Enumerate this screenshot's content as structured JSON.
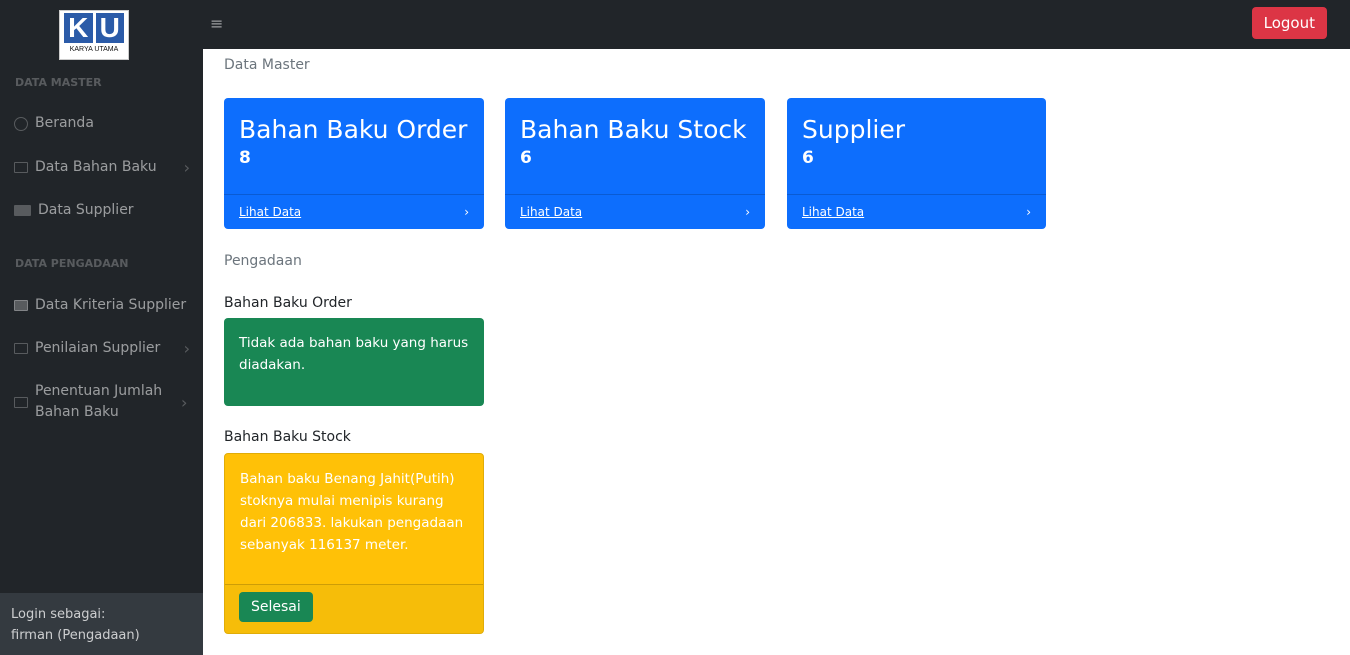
{
  "logo": {
    "letters": "KU",
    "caption": "KARYA UTAMA"
  },
  "sidebar": {
    "heading1": "DATA MASTER",
    "heading2": "DATA PENGADAAN",
    "items": [
      {
        "label": "Beranda"
      },
      {
        "label": "Data Bahan Baku"
      },
      {
        "label": "Data Supplier"
      },
      {
        "label": "Data Kriteria Supplier"
      },
      {
        "label": "Penilaian Supplier"
      },
      {
        "label": "Penentuan Jumlah Bahan Baku"
      }
    ],
    "footer_label": "Login sebagai:",
    "footer_user": "firman (Pengadaan)"
  },
  "topbar": {
    "menu_icon": "≡",
    "logout": "Logout"
  },
  "main": {
    "section1": "Data Master",
    "cards": [
      {
        "title": "Bahan Baku Order",
        "count": "8",
        "link": "Lihat Data"
      },
      {
        "title": "Bahan Baku Stock",
        "count": "6",
        "link": "Lihat Data"
      },
      {
        "title": "Supplier",
        "count": "6",
        "link": "Lihat Data"
      }
    ],
    "section2": "Pengadaan",
    "order_title": "Bahan Baku Order",
    "order_alert": "Tidak ada bahan baku yang harus diadakan.",
    "stock_title": "Bahan Baku Stock",
    "stock_alert": "Bahan baku Benang Jahit(Putih) stoknya mulai menipis kurang dari 206833. lakukan pengadaan sebanyak 116137 meter.",
    "done_button": "Selesai"
  }
}
